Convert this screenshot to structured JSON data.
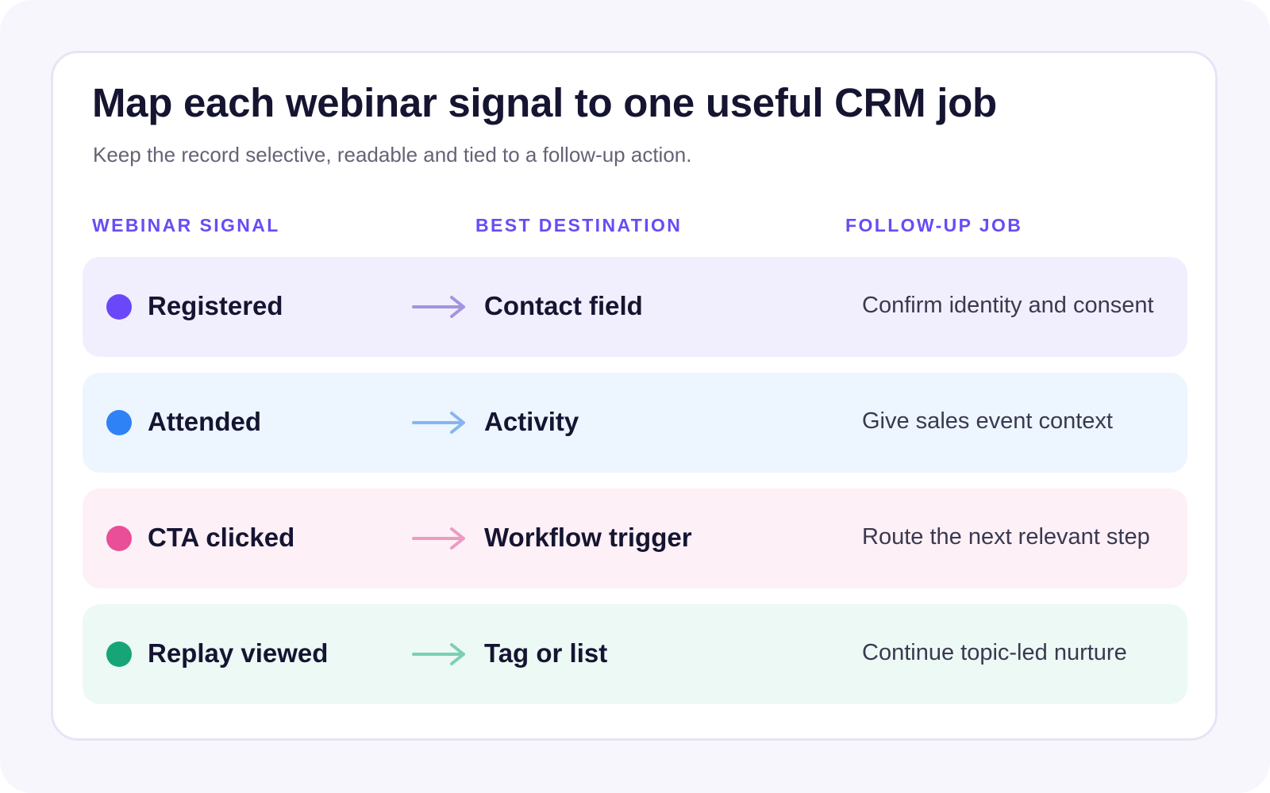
{
  "title": "Map each webinar signal to one useful CRM job",
  "subtitle": "Keep the record selective, readable and tied to a follow-up action.",
  "headers": {
    "signal": "WEBINAR SIGNAL",
    "destination": "BEST DESTINATION",
    "job": "FOLLOW-UP JOB"
  },
  "colors": {
    "accent": "#6a4bf5",
    "title": "#151532"
  },
  "rows": [
    {
      "signal": "Registered",
      "destination": "Contact field",
      "job": "Confirm identity and consent",
      "dot_color": "#6b47fa",
      "arrow_color": "#a394e0",
      "bg_color": "#f1effd"
    },
    {
      "signal": "Attended",
      "destination": "Activity",
      "job": "Give sales event context",
      "dot_color": "#2f82f5",
      "arrow_color": "#86b6f1",
      "bg_color": "#edf5fe"
    },
    {
      "signal": "CTA clicked",
      "destination": "Workflow trigger",
      "job": "Route the next relevant step",
      "dot_color": "#e84f98",
      "arrow_color": "#ec9bc2",
      "bg_color": "#fdf0f6"
    },
    {
      "signal": "Replay viewed",
      "destination": "Tag or list",
      "job": "Continue topic-led nurture",
      "dot_color": "#17a578",
      "arrow_color": "#7dcfb3",
      "bg_color": "#edf9f5"
    }
  ]
}
